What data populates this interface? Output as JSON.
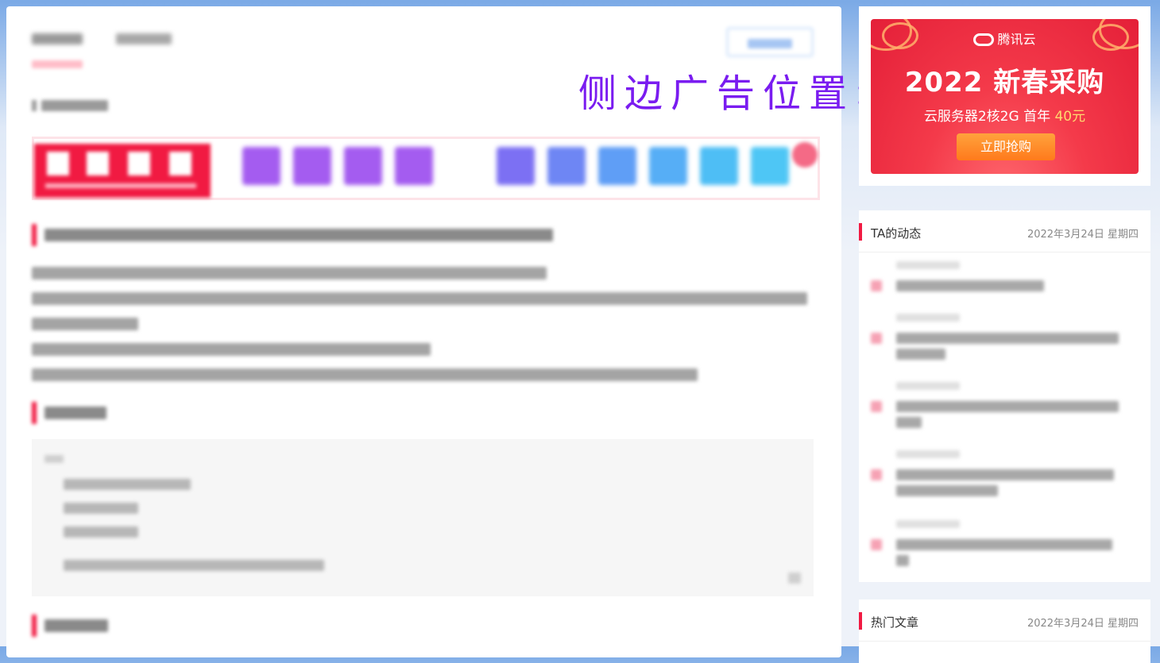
{
  "overlay": {
    "label": "侧边广告位置"
  },
  "ad": {
    "brand": "腾讯云",
    "title": "2022 新春采购",
    "subtitle": "云服务器2核2G  首年",
    "price": "40元",
    "button": "立即抢购"
  },
  "sidebar": {
    "activity": {
      "title": "TA的动态",
      "date": "2022年3月24日 星期四"
    },
    "hot": {
      "title": "热门文章",
      "date": "2022年3月24日 星期四"
    }
  },
  "colors": {
    "accent": "#f11a42",
    "overlay_text": "#7a1cf0",
    "ad_bg": "#e41f38",
    "ad_button": "#ff8a2a"
  }
}
